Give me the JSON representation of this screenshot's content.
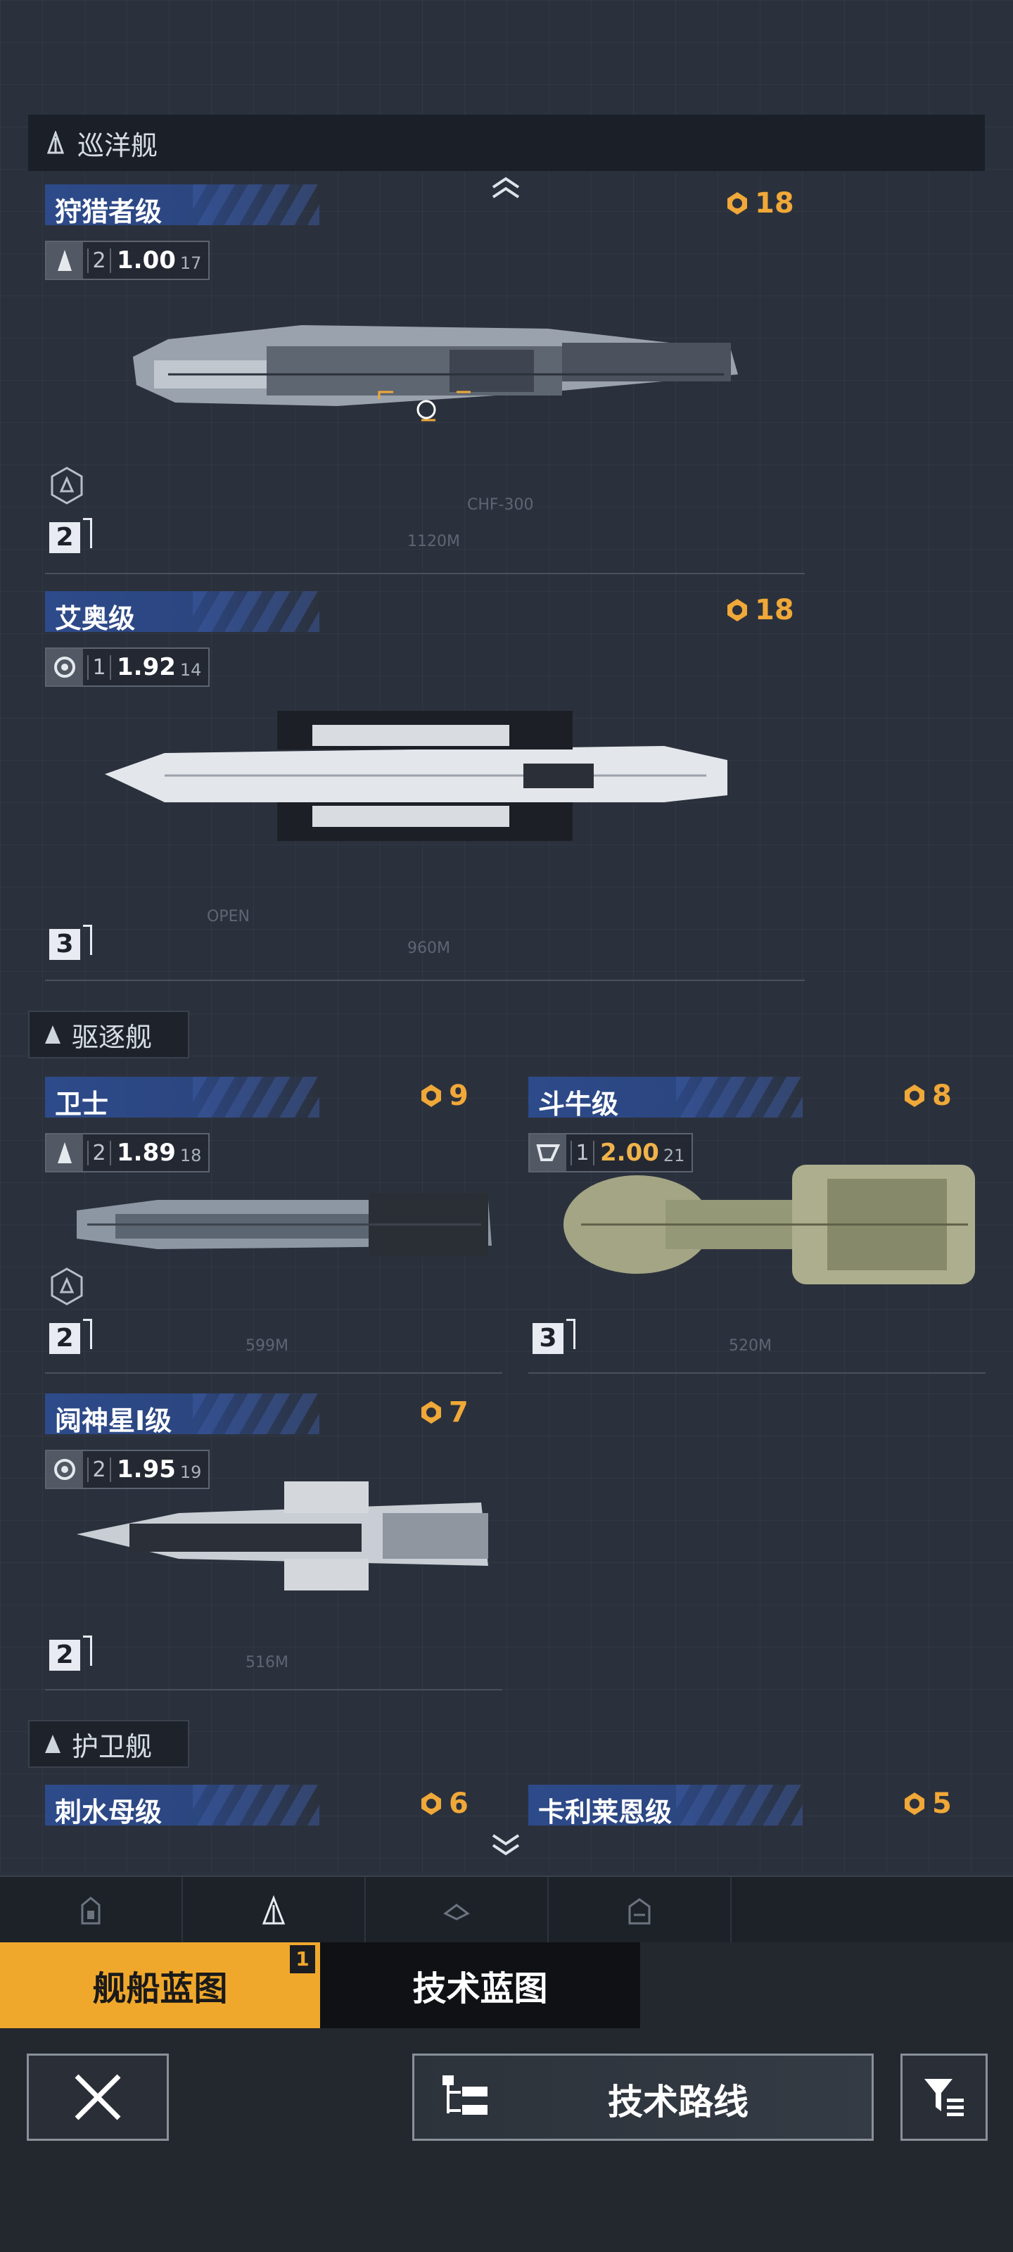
{
  "categories": {
    "cruiser": "巡洋舰",
    "destroyer": "驱逐舰",
    "frigate": "护卫舰"
  },
  "ships": [
    {
      "name": "狩猎者级",
      "cost": "18",
      "level": "2",
      "value": "1.00",
      "sub": "17",
      "tier": "2",
      "scale": "1120M",
      "label": "CHF-300"
    },
    {
      "name": "艾奥级",
      "cost": "18",
      "level": "1",
      "value": "1.92",
      "sub": "14",
      "tier": "3",
      "scale": "960M",
      "label": "OPEN"
    },
    {
      "name": "卫士",
      "cost": "9",
      "level": "2",
      "value": "1.89",
      "sub": "18",
      "tier": "2",
      "scale": "599M"
    },
    {
      "name": "斗牛级",
      "cost": "8",
      "level": "1",
      "value": "2.00",
      "sub": "21",
      "tier": "3",
      "scale": "520M"
    },
    {
      "name": "阋神星Ⅰ级",
      "cost": "7",
      "level": "2",
      "value": "1.95",
      "sub": "19",
      "tier": "2",
      "scale": "516M"
    },
    {
      "name": "刺水母级",
      "cost": "6"
    },
    {
      "name": "卡利莱恩级",
      "cost": "5"
    }
  ],
  "tabs": {
    "ship_blueprint": "舰船蓝图",
    "ship_blueprint_badge": "1",
    "tech_blueprint": "技术蓝图"
  },
  "buttons": {
    "tech_route": "技术路线"
  },
  "icons": {
    "cost": "laurel-emblem-icon",
    "close": "close-x-icon",
    "filter": "filter-list-icon",
    "route": "tree-structure-icon"
  },
  "colors": {
    "accent": "#f0a82c",
    "name_bar": "#2d4a8a",
    "background": "#2b313c"
  }
}
